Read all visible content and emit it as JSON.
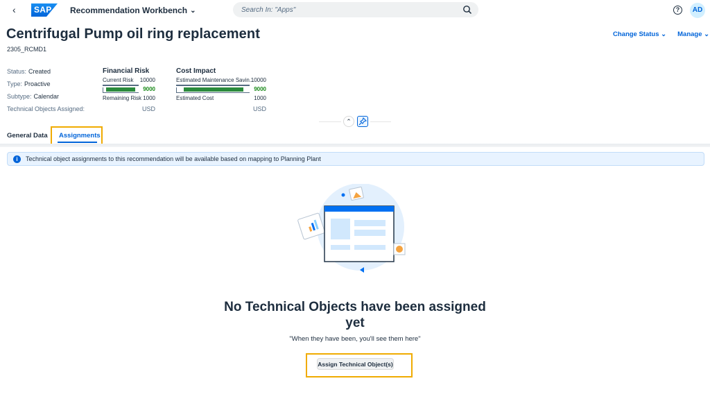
{
  "shell": {
    "back_icon": "chevron-left-icon",
    "logo_text": "SAP",
    "app_title": "Recommendation Workbench",
    "search_placeholder": "Search In: \"Apps\"",
    "avatar_initials": "AD"
  },
  "header": {
    "title": "Centrifugal Pump oil ring replacement",
    "id": "2305_RCMD1",
    "actions": {
      "change_status": "Change Status",
      "manage": "Manage"
    }
  },
  "attributes": {
    "status_label": "Status:",
    "status_value": "Created",
    "type_label": "Type:",
    "type_value": "Proactive",
    "subtype_label": "Subtype:",
    "subtype_value": "Calendar",
    "tech_label": "Technical Objects Assigned:"
  },
  "financial_risk": {
    "title": "Financial Risk",
    "current_label": "Current Risk",
    "current_value": "10000",
    "bar_value": "9000",
    "bar_fraction": 0.9,
    "remaining_label": "Remaining Risk",
    "remaining_value": "1000",
    "currency": "USD"
  },
  "cost_impact": {
    "title": "Cost Impact",
    "savings_label": "Estimated Maintenance Savin...",
    "savings_value": "10000",
    "bar_value": "9000",
    "bar_fraction": 0.9,
    "cost_label": "Estimated Cost",
    "cost_value": "1000",
    "currency": "USD"
  },
  "tabs": [
    {
      "label": "General Data",
      "selected": false
    },
    {
      "label": "Assignments",
      "selected": true
    }
  ],
  "info_strip": {
    "text": "Technical object assignments to this recommendation will be available based on mapping to Planning Plant"
  },
  "empty_state": {
    "title": "No Technical Objects have been assigned yet",
    "subtitle": "\"When they have been, you'll see them here\"",
    "button": "Assign Technical Object(s)"
  },
  "colors": {
    "accent": "#0064d9",
    "positive": "#2b8b3d",
    "highlight": "#f0ab00"
  }
}
